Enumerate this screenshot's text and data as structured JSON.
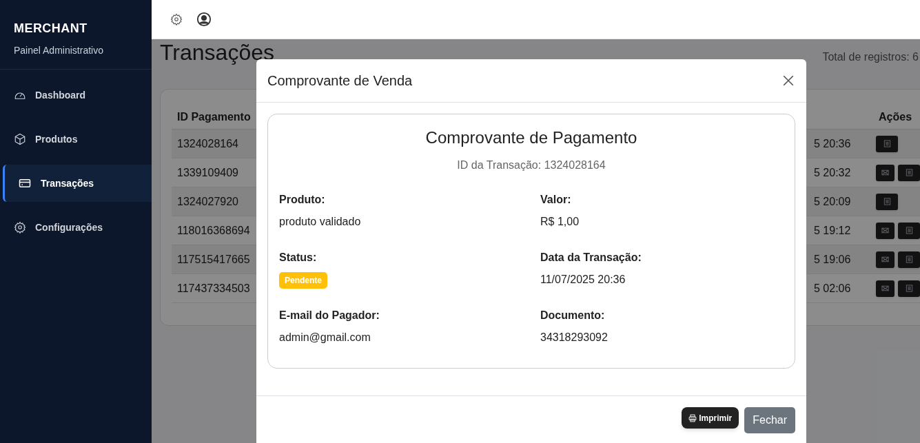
{
  "sidebar": {
    "brand": "MERCHANT",
    "subtitle": "Painel Administrativo",
    "items": [
      {
        "label": "Dashboard",
        "selected": false
      },
      {
        "label": "Produtos",
        "selected": false
      },
      {
        "label": "Transações",
        "selected": true
      },
      {
        "label": "Configurações",
        "selected": false
      }
    ]
  },
  "page": {
    "title": "Transações",
    "total": "Total de registros: 6"
  },
  "table": {
    "columns": [
      "ID Pagamento",
      "Ações"
    ],
    "rows": [
      {
        "id": "1324028164",
        "column_2": "5 20:36",
        "email_action": false
      },
      {
        "id": "1339109409",
        "column_2": "5 20:32",
        "email_action": true
      },
      {
        "id": "1324027920",
        "column_2": "5 20:09",
        "email_action": false
      },
      {
        "id": "118016368694",
        "column_2": "5 19:12",
        "email_action": true
      },
      {
        "id": "117515417665",
        "column_2": "5 19:06",
        "email_action": true
      },
      {
        "id": "117437334503",
        "column_2": "5 02:06",
        "email_action": true
      }
    ]
  },
  "modal": {
    "title": "Comprovante de Venda",
    "receipt_title": "Comprovante de Pagamento",
    "transaction_id": "ID da Transação: 1324028164",
    "fields": [
      {
        "label": "Produto:",
        "value": "produto validado",
        "kind": "text"
      },
      {
        "label": "Valor:",
        "value": "R$ 1,00",
        "kind": "text"
      },
      {
        "label": "Status:",
        "value": "Pendente",
        "kind": "badge",
        "color": "#ffc107"
      },
      {
        "label": "Data da Transação:",
        "value": "11/07/2025 20:36",
        "kind": "text"
      },
      {
        "label": "E-mail do Pagador:",
        "value": "admin@gmail.com",
        "kind": "text"
      },
      {
        "label": "Documento:",
        "value": "34318293092",
        "kind": "text"
      }
    ],
    "print_button": "Imprimir",
    "close_button": "Fechar"
  }
}
